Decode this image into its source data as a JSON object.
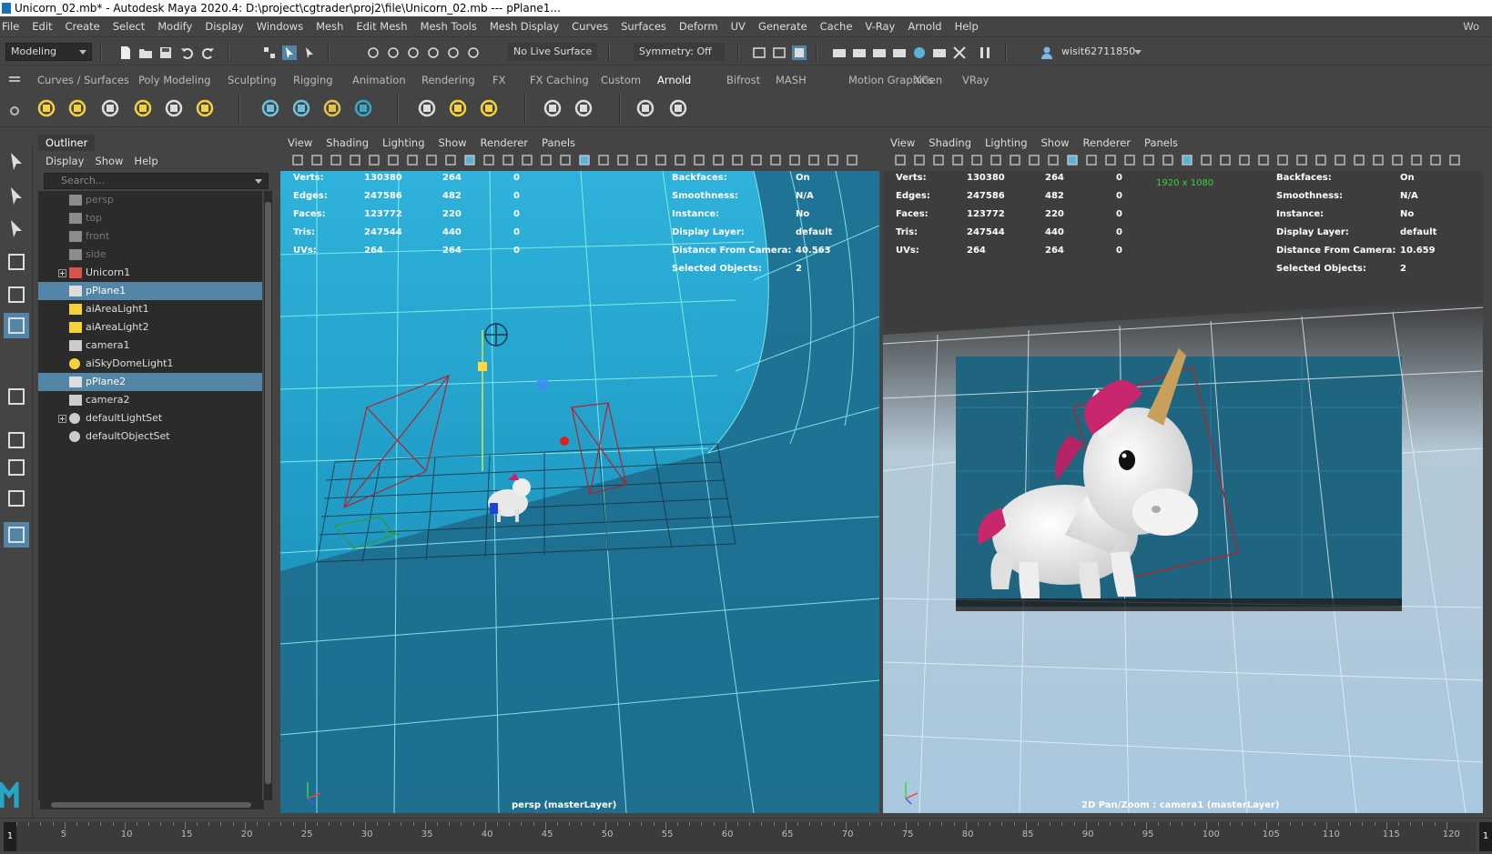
{
  "window": {
    "title": "Unicorn_02.mb* - Autodesk Maya 2020.4: D:\\project\\cgtrader\\proj2\\file\\Unicorn_02.mb  ---   pPlane1...",
    "title_right": "Wo"
  },
  "menubar": {
    "items": [
      "File",
      "Edit",
      "Create",
      "Select",
      "Modify",
      "Display",
      "Windows",
      "Mesh",
      "Edit Mesh",
      "Mesh Tools",
      "Mesh Display",
      "Curves",
      "Surfaces",
      "Deform",
      "UV",
      "Generate",
      "Cache",
      "V-Ray",
      "Arnold",
      "Help"
    ],
    "right": "Wo"
  },
  "statusline": {
    "mode": "Modeling",
    "live_surface": "No Live Surface",
    "symmetry": "Symmetry: Off",
    "user": "wisit62711850"
  },
  "shelf": {
    "tabs": [
      "Curves / Surfaces",
      "Poly Modeling",
      "Sculpting",
      "Rigging",
      "Animation",
      "Rendering",
      "FX",
      "FX Caching",
      "Custom",
      "Arnold",
      "Bifrost",
      "MASH",
      "Motion Graphics",
      "XGen",
      "VRay"
    ],
    "active_tab": "Arnold",
    "icons": [
      "light-icon",
      "sun-light-icon",
      "spot-light-icon",
      "sky-dome-icon",
      "mesh-light-icon",
      "photometric-light-icon",
      "standin-icon",
      "volume-icon",
      "curve-collector-icon",
      "shader-icon",
      "render-view-icon",
      "flush-cache-icon",
      "delete-cache-icon",
      "tx-manager-icon",
      "aov-icon",
      "ipr-icon",
      "render-icon"
    ]
  },
  "toolbox": {
    "tools": [
      "select-tool-icon",
      "lasso-tool-icon",
      "paint-select-icon",
      "move-tool-icon",
      "rotate-tool-icon",
      "scale-tool-icon",
      "single-pane-icon",
      "four-pane-icon",
      "persp-outliner-icon",
      "two-pane-icon",
      "outliner-layout-icon"
    ]
  },
  "outliner": {
    "title": "Outliner",
    "menu": [
      "Display",
      "Show",
      "Help"
    ],
    "search_placeholder": "Search...",
    "rows": [
      {
        "label": "persp",
        "icon": "camera-icon",
        "dim": true,
        "expand": false,
        "selected": false
      },
      {
        "label": "top",
        "icon": "camera-icon",
        "dim": true,
        "expand": false,
        "selected": false
      },
      {
        "label": "front",
        "icon": "camera-icon",
        "dim": true,
        "expand": false,
        "selected": false
      },
      {
        "label": "side",
        "icon": "camera-icon",
        "dim": true,
        "expand": false,
        "selected": false
      },
      {
        "label": "Unicorn1",
        "icon": "group-icon",
        "dim": false,
        "expand": true,
        "selected": false
      },
      {
        "label": "pPlane1",
        "icon": "mesh-icon",
        "dim": false,
        "expand": false,
        "selected": true
      },
      {
        "label": "aiAreaLight1",
        "icon": "area-light-icon",
        "dim": false,
        "expand": false,
        "selected": false
      },
      {
        "label": "aiAreaLight2",
        "icon": "area-light-icon",
        "dim": false,
        "expand": false,
        "selected": false
      },
      {
        "label": "camera1",
        "icon": "camera-icon",
        "dim": false,
        "expand": false,
        "selected": false
      },
      {
        "label": "aiSkyDomeLight1",
        "icon": "sky-dome-light-icon",
        "dim": false,
        "expand": false,
        "selected": false
      },
      {
        "label": "pPlane2",
        "icon": "mesh-icon",
        "dim": false,
        "expand": false,
        "selected": true
      },
      {
        "label": "camera2",
        "icon": "camera-icon",
        "dim": false,
        "expand": false,
        "selected": false
      },
      {
        "label": "defaultLightSet",
        "icon": "set-icon",
        "dim": false,
        "expand": true,
        "selected": false
      },
      {
        "label": "defaultObjectSet",
        "icon": "set-icon",
        "dim": false,
        "expand": false,
        "selected": false
      }
    ]
  },
  "viewports": {
    "left": {
      "menu": [
        "View",
        "Shading",
        "Lighting",
        "Show",
        "Renderer",
        "Panels"
      ],
      "stats": [
        {
          "label": "Verts:",
          "v1": "130380",
          "v2": "264",
          "v3": "0"
        },
        {
          "label": "Edges:",
          "v1": "247586",
          "v2": "482",
          "v3": "0"
        },
        {
          "label": "Faces:",
          "v1": "123772",
          "v2": "220",
          "v3": "0"
        },
        {
          "label": "Tris:",
          "v1": "247544",
          "v2": "440",
          "v3": "0"
        },
        {
          "label": "UVs:",
          "v1": "264",
          "v2": "264",
          "v3": "0"
        }
      ],
      "info": [
        {
          "label": "Backfaces:",
          "value": "On"
        },
        {
          "label": "Smoothness:",
          "value": "N/A"
        },
        {
          "label": "Instance:",
          "value": "No"
        },
        {
          "label": "Display Layer:",
          "value": "default"
        },
        {
          "label": "Distance From Camera:",
          "value": "40.563"
        },
        {
          "label": "Selected Objects:",
          "value": "2"
        }
      ],
      "camera_label": "persp (masterLayer)"
    },
    "right": {
      "menu": [
        "View",
        "Shading",
        "Lighting",
        "Show",
        "Renderer",
        "Panels"
      ],
      "stats": [
        {
          "label": "Verts:",
          "v1": "130380",
          "v2": "264",
          "v3": "0"
        },
        {
          "label": "Edges:",
          "v1": "247586",
          "v2": "482",
          "v3": "0"
        },
        {
          "label": "Faces:",
          "v1": "123772",
          "v2": "220",
          "v3": "0"
        },
        {
          "label": "Tris:",
          "v1": "247544",
          "v2": "440",
          "v3": "0"
        },
        {
          "label": "UVs:",
          "v1": "264",
          "v2": "264",
          "v3": "0"
        }
      ],
      "info": [
        {
          "label": "Backfaces:",
          "value": "On"
        },
        {
          "label": "Smoothness:",
          "value": "N/A"
        },
        {
          "label": "Instance:",
          "value": "No"
        },
        {
          "label": "Display Layer:",
          "value": "default"
        },
        {
          "label": "Distance From Camera:",
          "value": "10.659"
        },
        {
          "label": "Selected Objects:",
          "value": "2"
        }
      ],
      "resolution": "1920 x 1080",
      "camera_label": "2D Pan/Zoom : camera1 (masterLayer)"
    }
  },
  "timeline": {
    "current_frame": "1",
    "labels": [
      "5",
      "10",
      "15",
      "20",
      "25",
      "30",
      "35",
      "40",
      "45",
      "50",
      "55",
      "60",
      "65",
      "70",
      "75",
      "80",
      "85",
      "90",
      "95",
      "100",
      "105",
      "110",
      "115",
      "120"
    ],
    "end_frame": "1"
  }
}
